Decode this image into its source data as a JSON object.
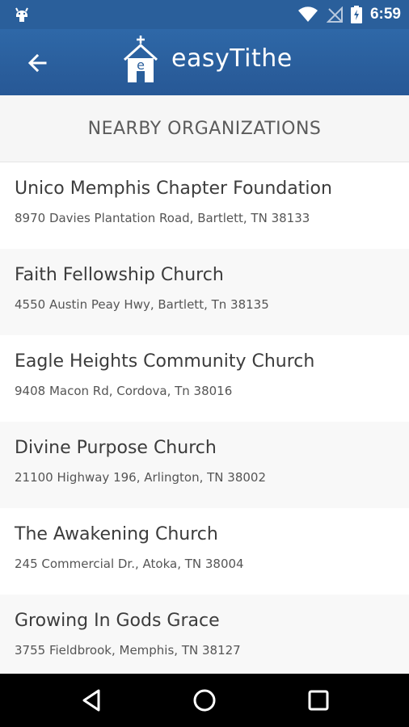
{
  "status_bar": {
    "time": "6:59",
    "icons": [
      "android-debug-icon",
      "wifi-icon",
      "no-signal-icon",
      "battery-charging-icon"
    ]
  },
  "app_bar": {
    "brand": "easyTithe",
    "back_icon": "arrow-back-icon",
    "logo_icon": "church-logo-icon"
  },
  "section": {
    "title": "NEARBY ORGANIZATIONS"
  },
  "organizations": [
    {
      "name": "Unico Memphis Chapter Foundation",
      "address": "8970 Davies Plantation Road, Bartlett, TN 38133"
    },
    {
      "name": "Faith Fellowship Church",
      "address": "4550 Austin Peay Hwy, Bartlett, Tn 38135"
    },
    {
      "name": "Eagle Heights Community Church",
      "address": "9408 Macon Rd, Cordova, Tn 38016"
    },
    {
      "name": "Divine Purpose Church",
      "address": "21100 Highway 196, Arlington, TN 38002"
    },
    {
      "name": "The Awakening Church",
      "address": "245 Commercial Dr., Atoka, TN 38004"
    },
    {
      "name": "Growing In Gods Grace",
      "address": "3755 Fieldbrook, Memphis, TN 38127"
    }
  ],
  "nav_bar": {
    "icons": [
      "back-triangle-icon",
      "home-circle-icon",
      "recents-square-icon"
    ]
  },
  "colors": {
    "app_bar": "#2a5f9b",
    "header_bg": "#f6f6f6",
    "alt_row_bg": "#f8f8f8",
    "nav_bar": "#000000"
  }
}
